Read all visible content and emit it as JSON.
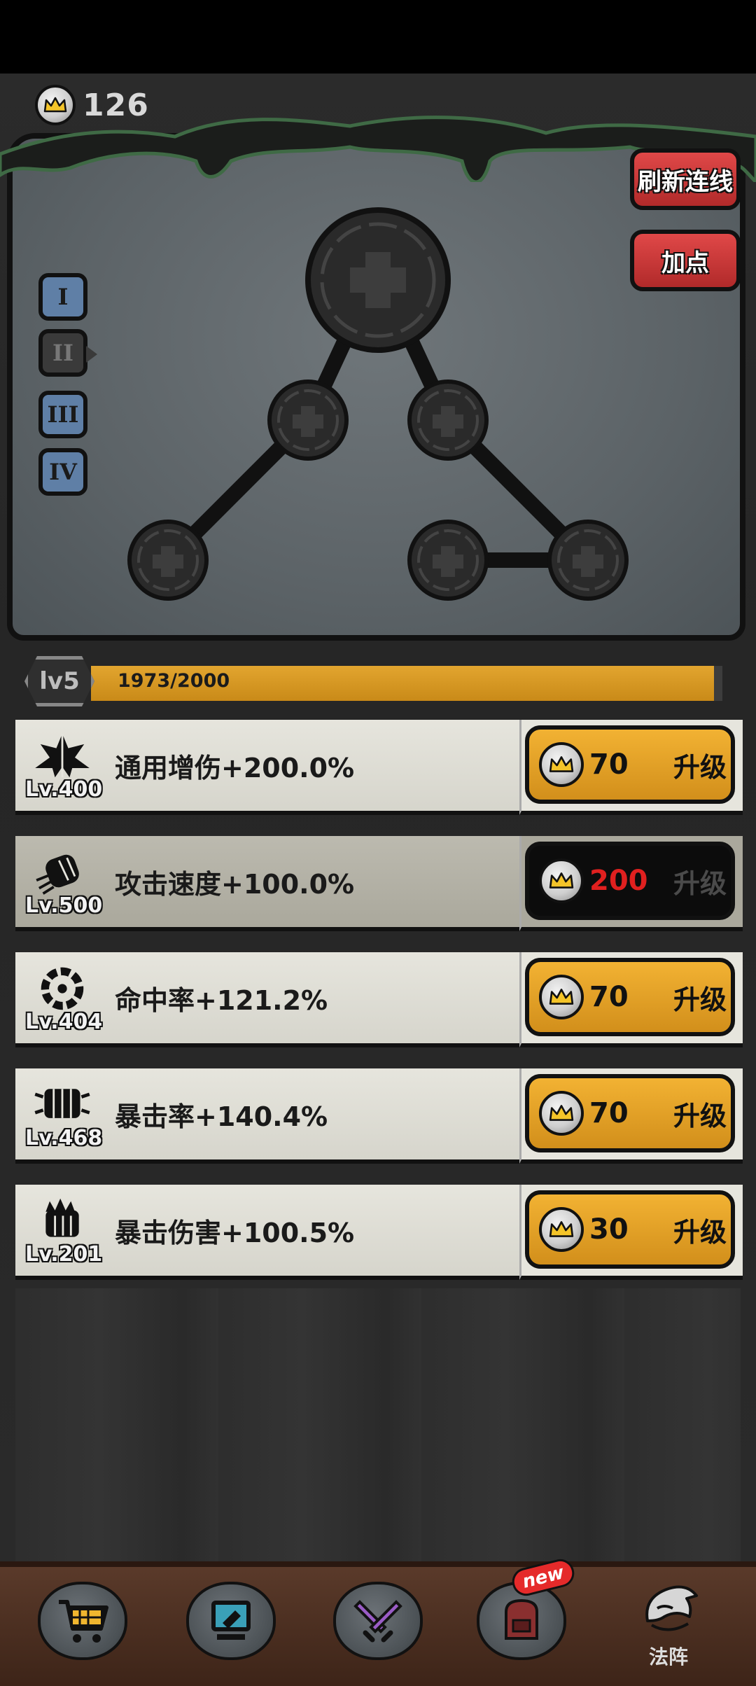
{
  "currency": {
    "amount": "126",
    "icon": "crown-coin-icon"
  },
  "skill_tree": {
    "tiers": [
      "I",
      "II",
      "III",
      "IV"
    ],
    "active_tier_index": 1,
    "buttons": {
      "refresh_links": "刷新连线",
      "add_point": "加点"
    }
  },
  "level": {
    "badge": "lv5",
    "xp_text": "1973/2000",
    "progress": 0.9865
  },
  "upgrades": [
    {
      "level": "Lv.400",
      "name": "通用增伤+200.0%",
      "cost": "70",
      "action": "升级",
      "affordable": true,
      "icon": "star-burst-icon"
    },
    {
      "level": "Lv.500",
      "name": "攻击速度+100.0%",
      "cost": "200",
      "action": "升级",
      "affordable": false,
      "icon": "fist-icon"
    },
    {
      "level": "Lv.404",
      "name": "命中率+121.2%",
      "cost": "70",
      "action": "升级",
      "affordable": true,
      "icon": "target-ring-icon"
    },
    {
      "level": "Lv.468",
      "name": "暴击率+140.4%",
      "cost": "70",
      "action": "升级",
      "affordable": true,
      "icon": "smash-fist-icon"
    },
    {
      "level": "Lv.201",
      "name": "暴击伤害+100.5%",
      "cost": "30",
      "action": "升级",
      "affordable": true,
      "icon": "spiked-fist-icon"
    }
  ],
  "nav": {
    "items": [
      {
        "icon": "shop-cart-icon"
      },
      {
        "icon": "computer-icon"
      },
      {
        "icon": "crossed-swords-icon"
      },
      {
        "icon": "backpack-icon",
        "badge": "new"
      }
    ],
    "active": {
      "icon": "sage-helmet-icon",
      "label": "法阵"
    }
  },
  "colors": {
    "accent_gold": "#e2a52f",
    "danger_red": "#e0201f",
    "button_red": "#d23a3a",
    "tier_blue": "#5f7fa6"
  }
}
